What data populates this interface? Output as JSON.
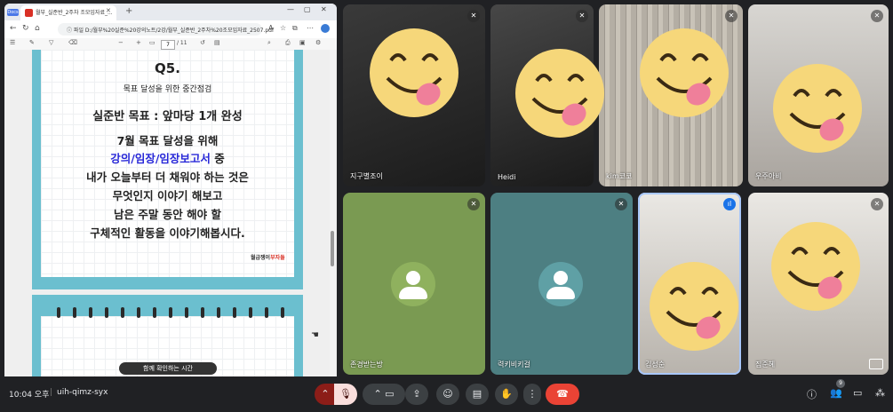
{
  "browser": {
    "tabs_badge": "Docs",
    "tab_title": "월부_실준반_2주차 조모임자료_...",
    "new_tab": "+",
    "controls": [
      "—",
      "▢",
      "✕"
    ]
  },
  "address": {
    "prefix": "파일",
    "url": "D:/월부%20실준%20강의노트/2강/월부_실준반_2주차%20조모임자료_2507.pdf"
  },
  "pdf_toolbar": {
    "page": "7",
    "total": "/ 11"
  },
  "slide": {
    "title": "Q5.",
    "subtitle": "목표 달성을 위한 중간점검",
    "goal": "실준반 목표 : 앞마당 1개 완성",
    "line1": "7월 목표 달성을 위해",
    "line2_blue": "강의/임장/임장보고서",
    "line2_rest": " 중",
    "line3": "내가 오늘부터 더 채워야 하는 것은",
    "line4": "무엇인지 이야기 해보고",
    "line5": "남은 주말 동안 해야 할",
    "line6": "구체적인 활동을 이야기해봅시다.",
    "logo_a": "월급쟁이",
    "logo_b": "부자들",
    "next_pill": "함께 확인하는 시간"
  },
  "participants": [
    {
      "name": "지구별조이",
      "muted": true
    },
    {
      "name": "Heidi",
      "muted": true
    },
    {
      "name": "kim코코",
      "muted": true
    },
    {
      "name": "우주아비",
      "muted": true
    },
    {
      "name": "존경받는방",
      "muted": true
    },
    {
      "name": "력키비키걸",
      "muted": true
    },
    {
      "name": "김성순",
      "muted": false,
      "speaking": true
    },
    {
      "name": "짐준혜",
      "muted": true
    }
  ],
  "meeting": {
    "time": "10:04 오후",
    "separator": "|",
    "code": "uih-qimz-syx",
    "participant_count": "9"
  },
  "colors": {
    "end_call": "#ea4335",
    "accent": "#1a73e8",
    "slide_frame": "#6bbfcf",
    "slide_blue_text": "#2828d8"
  }
}
